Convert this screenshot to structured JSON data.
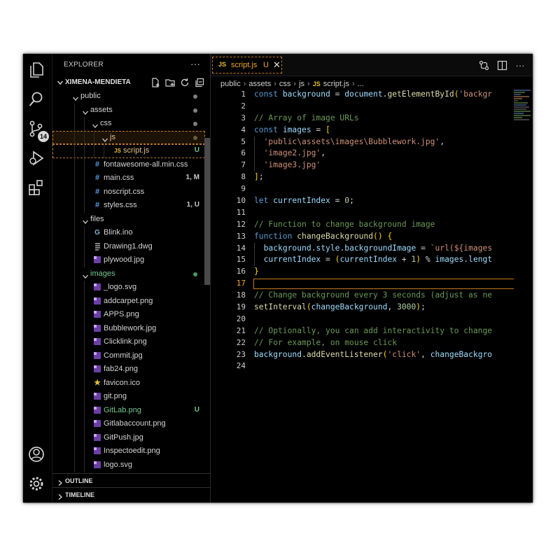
{
  "explorer": {
    "title": "EXPLORER",
    "more_label": "···",
    "root_label": "XIMENA-MENDIETA",
    "sections": {
      "outline": "OUTLINE",
      "timeline": "TIMELINE"
    }
  },
  "activity": {
    "source_control_badge": "14"
  },
  "tree": [
    {
      "label": "public",
      "kind": "folder",
      "status": "dot"
    },
    {
      "label": "assets",
      "kind": "folder",
      "status": "dot"
    },
    {
      "label": "css",
      "kind": "folder",
      "status": "dot"
    },
    {
      "label": "js",
      "kind": "folder",
      "status": "dot"
    },
    {
      "label": "script.js",
      "kind": "js",
      "status": "U"
    },
    {
      "label": "fontawesome-all.min.css",
      "kind": "css",
      "status": ""
    },
    {
      "label": "main.css",
      "kind": "css",
      "status": "1, M"
    },
    {
      "label": "noscript.css",
      "kind": "css",
      "status": ""
    },
    {
      "label": "styles.css",
      "kind": "css",
      "status": "1, U"
    },
    {
      "label": "files",
      "kind": "folder",
      "status": ""
    },
    {
      "label": "Blink.ino",
      "kind": "ino",
      "status": ""
    },
    {
      "label": "Drawing1.dwg",
      "kind": "file",
      "status": ""
    },
    {
      "label": "plywood.jpg",
      "kind": "image",
      "status": ""
    },
    {
      "label": "images",
      "kind": "folder",
      "status": "dot-green"
    },
    {
      "label": "_logo.svg",
      "kind": "svg",
      "status": ""
    },
    {
      "label": "addcarpet.png",
      "kind": "image",
      "status": ""
    },
    {
      "label": "APPS.png",
      "kind": "image",
      "status": ""
    },
    {
      "label": "Bubblework.jpg",
      "kind": "image",
      "status": ""
    },
    {
      "label": "Clicklink.png",
      "kind": "image",
      "status": ""
    },
    {
      "label": "Commit.jpg",
      "kind": "image",
      "status": ""
    },
    {
      "label": "fab24.png",
      "kind": "image",
      "status": ""
    },
    {
      "label": "favicon.ico",
      "kind": "star",
      "status": ""
    },
    {
      "label": "git.png",
      "kind": "image",
      "status": ""
    },
    {
      "label": "GitLab.png",
      "kind": "image",
      "status": "U"
    },
    {
      "label": "Gitlabaccount.png",
      "kind": "image",
      "status": ""
    },
    {
      "label": "GitPush.jpg",
      "kind": "image",
      "status": ""
    },
    {
      "label": "Inspectoedit.png",
      "kind": "image",
      "status": ""
    },
    {
      "label": "logo.svg",
      "kind": "svg",
      "status": ""
    }
  ],
  "tab": {
    "icon": "JS",
    "name": "script.js",
    "status": "U",
    "close": "✕"
  },
  "breadcrumb": [
    "public",
    "assets",
    "css",
    "js",
    "script.js",
    "..."
  ],
  "code_lines": [
    [
      [
        "kw",
        "const "
      ],
      [
        "vr",
        "background"
      ],
      [
        "pn",
        " = "
      ],
      [
        "vr",
        "document"
      ],
      [
        "pn",
        "."
      ],
      [
        "fn",
        "getElementById"
      ],
      [
        "br",
        "("
      ],
      [
        "st",
        "'backgr"
      ]
    ],
    [],
    [
      [
        "cm",
        "// Array of image URLs"
      ]
    ],
    [
      [
        "kw",
        "const "
      ],
      [
        "vr",
        "images"
      ],
      [
        "pn",
        " = "
      ],
      [
        "br",
        "["
      ]
    ],
    [
      [
        "pn",
        "  "
      ],
      [
        "st",
        "'public\\assets\\images\\Bubblework.jpg'"
      ],
      [
        "pn",
        ","
      ]
    ],
    [
      [
        "pn",
        "  "
      ],
      [
        "st",
        "'image2.jpg'"
      ],
      [
        "pn",
        ","
      ]
    ],
    [
      [
        "pn",
        "  "
      ],
      [
        "st",
        "'image3.jpg'"
      ]
    ],
    [
      [
        "br",
        "]"
      ],
      [
        "pn",
        ";"
      ]
    ],
    [],
    [
      [
        "kw",
        "let "
      ],
      [
        "vr",
        "currentIndex"
      ],
      [
        "pn",
        " = "
      ],
      [
        "nm",
        "0"
      ],
      [
        "pn",
        ";"
      ]
    ],
    [],
    [
      [
        "cm",
        "// Function to change background image"
      ]
    ],
    [
      [
        "kw",
        "function "
      ],
      [
        "fn",
        "changeBackground"
      ],
      [
        "br",
        "() {"
      ]
    ],
    [
      [
        "pn",
        "  "
      ],
      [
        "vr",
        "background"
      ],
      [
        "pn",
        "."
      ],
      [
        "vr",
        "style"
      ],
      [
        "pn",
        "."
      ],
      [
        "vr",
        "backgroundImage"
      ],
      [
        "pn",
        " = "
      ],
      [
        "st",
        "`url(${images"
      ]
    ],
    [
      [
        "pn",
        "  "
      ],
      [
        "vr",
        "currentIndex"
      ],
      [
        "pn",
        " = "
      ],
      [
        "br",
        "("
      ],
      [
        "vr",
        "currentIndex"
      ],
      [
        "pn",
        " + "
      ],
      [
        "nm",
        "1"
      ],
      [
        "br",
        ")"
      ],
      [
        "pn",
        " % "
      ],
      [
        "vr",
        "images"
      ],
      [
        "pn",
        "."
      ],
      [
        "vr",
        "lengt"
      ]
    ],
    [
      [
        "br",
        "}"
      ]
    ],
    [],
    [
      [
        "cm",
        "// Change background every 3 seconds (adjust as ne"
      ]
    ],
    [
      [
        "fn",
        "setInterval"
      ],
      [
        "br",
        "("
      ],
      [
        "vr",
        "changeBackground"
      ],
      [
        "pn",
        ", "
      ],
      [
        "nm",
        "3000"
      ],
      [
        "br",
        ")"
      ],
      [
        "pn",
        ";"
      ]
    ],
    [],
    [
      [
        "cm",
        "// Optionally, you can add interactivity to change"
      ]
    ],
    [
      [
        "cm",
        "// For example, on mouse click"
      ]
    ],
    [
      [
        "vr",
        "background"
      ],
      [
        "pn",
        "."
      ],
      [
        "fn",
        "addEventListener"
      ],
      [
        "br",
        "("
      ],
      [
        "st",
        "'click'"
      ],
      [
        "pn",
        ", "
      ],
      [
        "vr",
        "changeBackgro"
      ]
    ],
    []
  ],
  "line_numbers": [
    "1",
    "2",
    "3",
    "4",
    "5",
    "6",
    "7",
    "8",
    "9",
    "10",
    "11",
    "12",
    "13",
    "14",
    "15",
    "16",
    "17",
    "18",
    "19",
    "20",
    "21",
    "22",
    "23",
    "24"
  ],
  "colors": {
    "accent": "#c47a1c",
    "tab_text": "#f0a830",
    "background": "#000000"
  },
  "icons": [
    "files-icon",
    "search-icon",
    "source-control-icon",
    "run-debug-icon",
    "extensions-icon",
    "account-icon",
    "settings-gear-icon",
    "new-file-icon",
    "new-folder-icon",
    "refresh-icon",
    "collapse-all-icon",
    "split-editor-icon",
    "compare-icon"
  ]
}
